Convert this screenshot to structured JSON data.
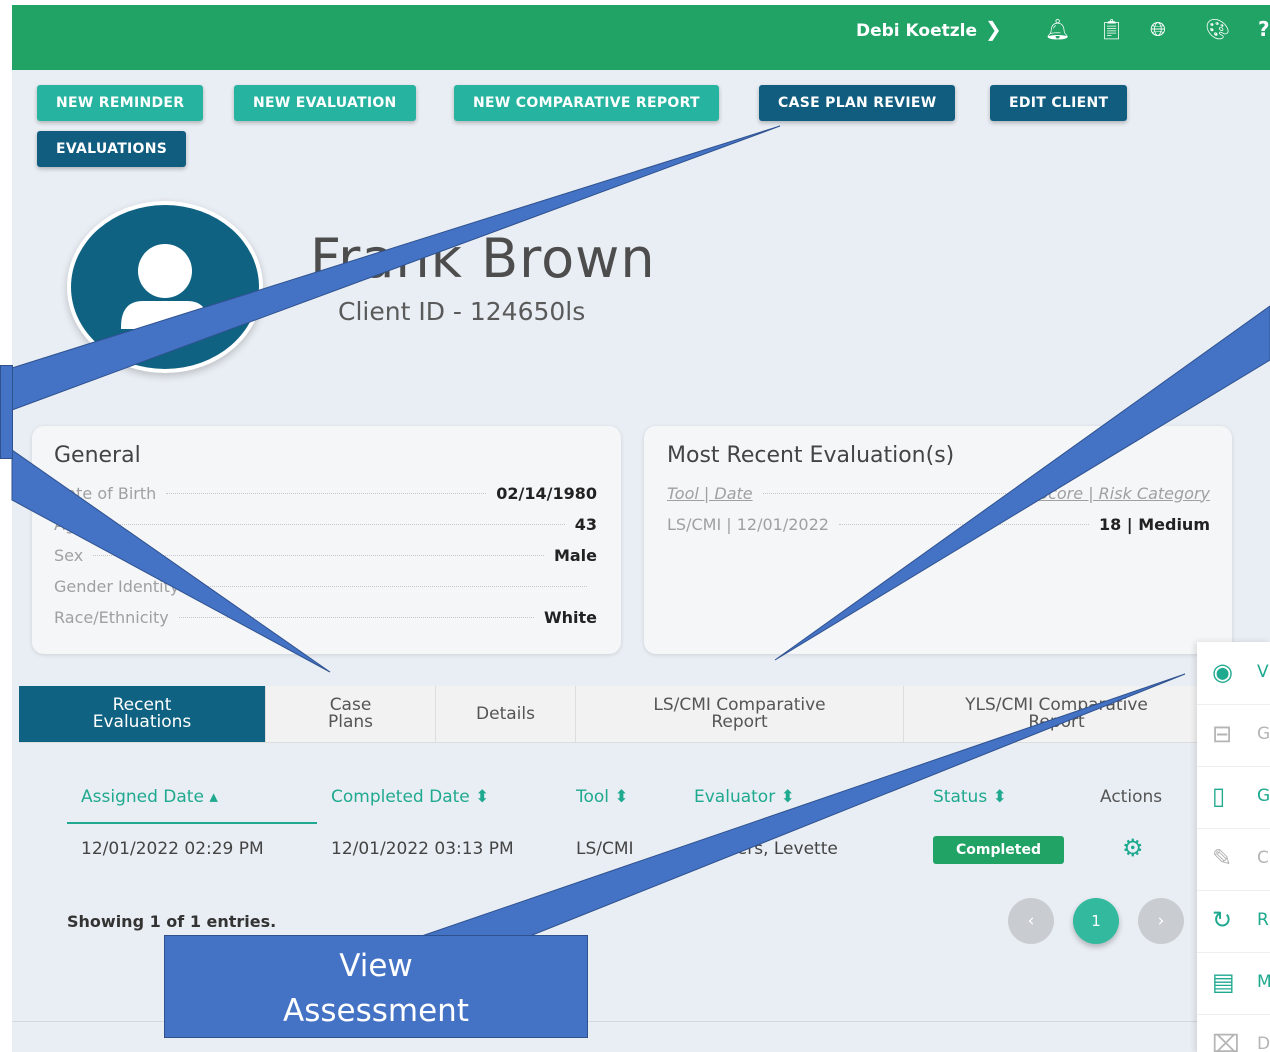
{
  "topbar": {
    "user_name": "Debi Koetzle",
    "user_chevron": "❯",
    "icons": [
      "bell-icon",
      "clipboard-icon",
      "globe-icon",
      "palette-icon",
      "help-icon"
    ],
    "help_glyph": "?"
  },
  "actions": {
    "new_reminder": "NEW REMINDER",
    "new_evaluation": "NEW EVALUATION",
    "new_comparative_report": "NEW COMPARATIVE REPORT",
    "case_plan_review": "CASE PLAN REVIEW",
    "edit_client": "EDIT CLIENT",
    "evaluations": "EVALUATIONS"
  },
  "client": {
    "name": "Frank Brown",
    "client_id": "Client ID - 124650ls"
  },
  "general": {
    "title": "General",
    "rows": [
      {
        "label": "Date of Birth",
        "value": "02/14/1980"
      },
      {
        "label": "Age",
        "value": "43"
      },
      {
        "label": "Sex",
        "value": "Male"
      },
      {
        "label": "Gender Identity",
        "value": ""
      },
      {
        "label": "Race/Ethnicity",
        "value": "White"
      }
    ]
  },
  "recent": {
    "title": "Most Recent Evaluation(s)",
    "header_left": "Tool | Date",
    "header_right": "Score | Risk Category",
    "row_left": "LS/CMI | 12/01/2022",
    "row_right": "18 | Medium"
  },
  "tabs": [
    {
      "label": "Recent Evaluations",
      "active": true
    },
    {
      "label": "Case Plans",
      "active": false
    },
    {
      "label": "Details",
      "active": false
    },
    {
      "label": "LS/CMI Comparative Report",
      "active": false
    },
    {
      "label": "YLS/CMI Comparative Report",
      "active": false
    }
  ],
  "table": {
    "headers": {
      "assigned": "Assigned Date ▴",
      "completed": "Completed Date ⬍",
      "tool": "Tool ⬍",
      "evaluator": "Evaluator ⬍",
      "status": "Status ⬍",
      "actions": "Actions"
    },
    "row": {
      "assigned": "12/01/2022 02:29 PM",
      "completed": "12/01/2022 03:13 PM",
      "tool": "LS/CMI",
      "evaluator": "Sanders, Levette",
      "status": "Completed"
    },
    "showing": "Showing 1 of 1 entries.",
    "pagination": {
      "prev": "‹",
      "current": "1",
      "next": "›"
    }
  },
  "action_menu": [
    {
      "icon": "eye-icon",
      "glyph": "👁",
      "text": "V",
      "enabled": true
    },
    {
      "icon": "briefcase-icon",
      "glyph": "💼",
      "text": "G",
      "enabled": false
    },
    {
      "icon": "clipboard-icon",
      "glyph": "📋",
      "text": "G",
      "enabled": true
    },
    {
      "icon": "edit-icon",
      "glyph": "✎",
      "text": "C",
      "enabled": false
    },
    {
      "icon": "refresh-icon",
      "glyph": "↻",
      "text": "R",
      "enabled": true
    },
    {
      "icon": "document-icon",
      "glyph": "🗎",
      "text": "M",
      "enabled": true
    },
    {
      "icon": "trash-icon",
      "glyph": "🗑",
      "text": "D",
      "enabled": false
    }
  ],
  "annotation": {
    "callout_text_line1": "View",
    "callout_text_line2": "Assessment",
    "color": "#4472c4"
  },
  "colors": {
    "topbar": "#21a366",
    "teal_button": "#26b3a0",
    "navy_button": "#105d80",
    "accent": "#1fa98f"
  }
}
